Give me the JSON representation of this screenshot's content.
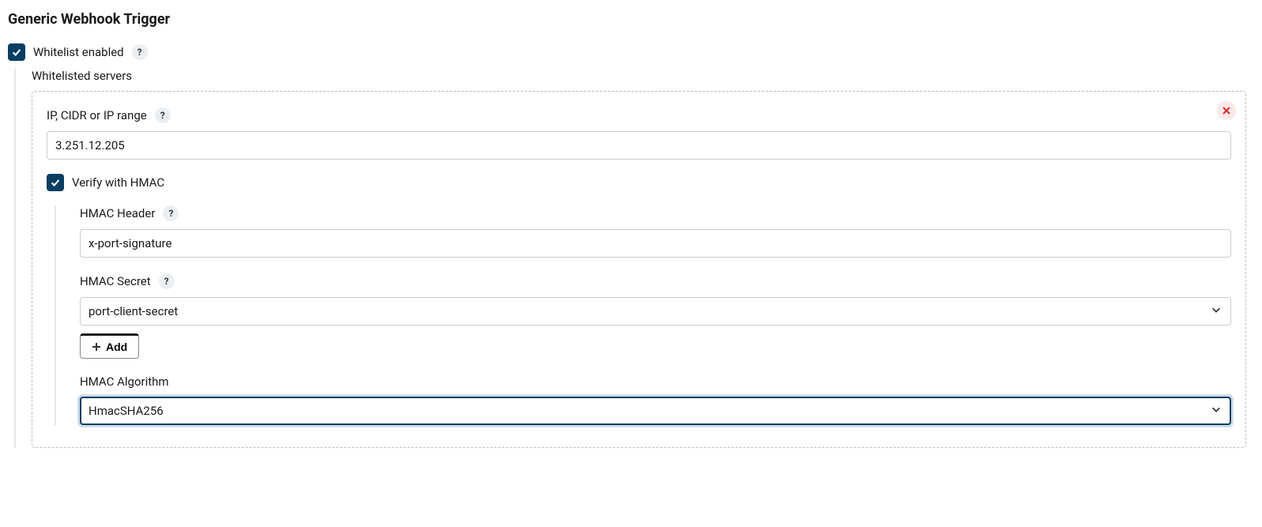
{
  "section_title": "Generic Webhook Trigger",
  "whitelist": {
    "checkbox_label": "Whitelist enabled",
    "servers_label": "Whitelisted servers"
  },
  "server_entry": {
    "ip_label": "IP, CIDR or IP range",
    "ip_value": "3.251.12.205",
    "verify_hmac_label": "Verify with HMAC"
  },
  "hmac": {
    "header_label": "HMAC Header",
    "header_value": "x-port-signature",
    "secret_label": "HMAC Secret",
    "secret_value": "port-client-secret",
    "add_label": "Add",
    "algorithm_label": "HMAC Algorithm",
    "algorithm_value": "HmacSHA256"
  }
}
